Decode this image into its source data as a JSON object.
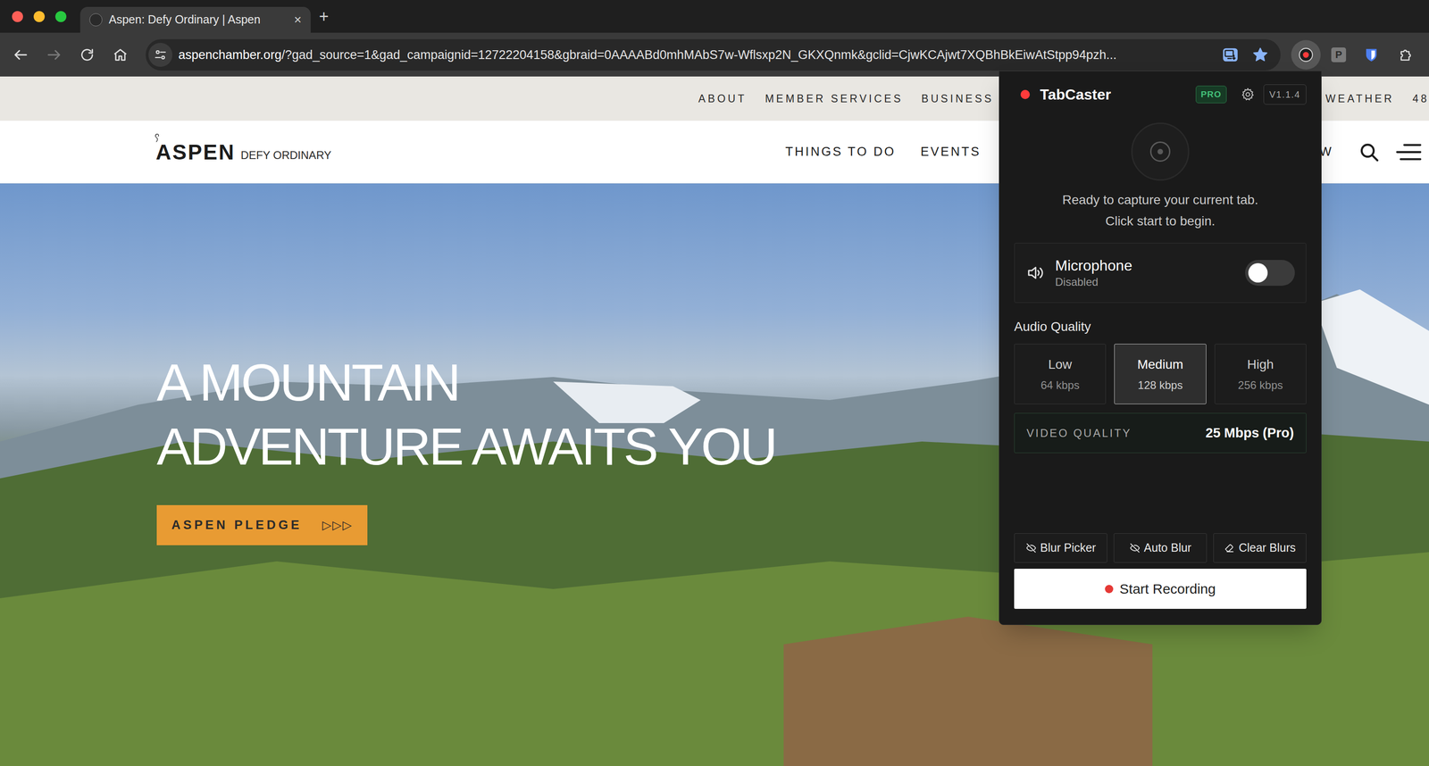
{
  "browser": {
    "tabs": [
      {
        "label": "Aspen: Defy Ordinary | Aspen",
        "selected": true,
        "close": "×"
      }
    ],
    "new_tab": "+",
    "forward_enabled": false,
    "address": {
      "host": "aspenchamber.org",
      "rest": "/?gad_source=1&gad_campaignid=12722204158&gbraid=0AAAABd0mhMAbS7w-Wflsxp2N_GKXQnmk&gclid=CjwKCAjwt7XQBhBkEiwAtStpp94pzh..."
    },
    "bookmarked": true,
    "extensions": {
      "tabcaster_active": true,
      "p_label": "P"
    }
  },
  "site": {
    "utility_nav": [
      "ABOUT",
      "MEMBER SERVICES",
      "BUSINESS"
    ],
    "utility_nav_right": [
      "WEATHER",
      "48"
    ],
    "logo": {
      "name": "ASPEN",
      "tagline": "DEFY ORDINARY"
    },
    "main_nav": [
      "THINGS TO DO",
      "EVENTS"
    ],
    "main_nav_right": [
      "W"
    ],
    "hero": {
      "lines": [
        "A MOUNTAIN",
        "ADVENTURE AWAITS YOU"
      ],
      "button": "ASPEN PLEDGE",
      "button_arrows": "▷▷▷"
    }
  },
  "popup": {
    "title": "TabCaster",
    "badge": "PRO",
    "version": "V1.1.4",
    "status": [
      "Ready to capture your current tab.",
      "Click start to begin."
    ],
    "microphone": {
      "label": "Microphone",
      "status": "Disabled",
      "on": false
    },
    "audio_quality": {
      "label": "Audio Quality",
      "options": [
        {
          "label": "Low",
          "rate": "64 kbps",
          "selected": false
        },
        {
          "label": "Medium",
          "rate": "128 kbps",
          "selected": true
        },
        {
          "label": "High",
          "rate": "256 kbps",
          "selected": false
        }
      ]
    },
    "video_quality": {
      "label": "VIDEO QUALITY",
      "value": "25 Mbps (Pro)"
    },
    "tools": [
      "Blur Picker",
      "Auto Blur",
      "Clear Blurs"
    ],
    "start_button": "Start Recording"
  }
}
